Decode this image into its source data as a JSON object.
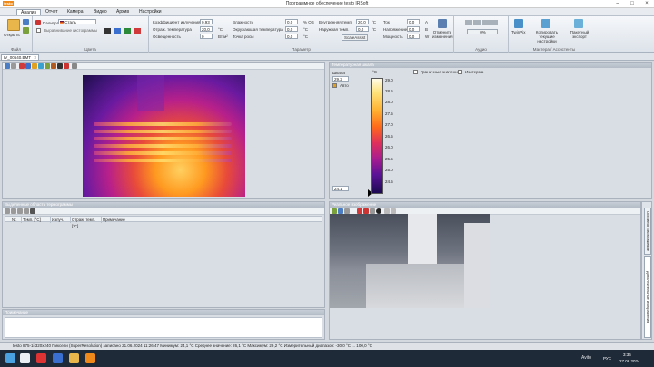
{
  "window": {
    "title": "Программное обеспечение testo IRSoft",
    "logo": "testo"
  },
  "menu": [
    "Анализ",
    "Отчет",
    "Камера",
    "Видео",
    "Архив",
    "Настройки"
  ],
  "ribbon": {
    "file": {
      "open": "Открыть",
      "label": "Файл"
    },
    "color": {
      "palette_label": "Палитра",
      "palette_value": "Сталь",
      "histogram": "Выравнивание гистограммы",
      "label": "Цвета"
    },
    "params": {
      "emissivity_label": "Коэффициент излучения",
      "emissivity": "0,93",
      "reflected_label": "Отраж. температура",
      "reflected": "20,0",
      "reflected_unit": "°C",
      "irradiance_label": "Освещенность",
      "irradiance": "0",
      "irradiance_unit": "Вт/м²",
      "humidity_label": "Влажность",
      "humidity": "0,0",
      "humidity_unit": "% ОВ",
      "ambient_label": "Окружающая температура",
      "ambient": "0,0",
      "ambient_unit": "°C",
      "dew_label": "Точка росы",
      "dew": "0,0",
      "dew_unit": "°C",
      "inner_label": "Внутренняя темп.",
      "inner": "20,0",
      "inner_unit": "°C",
      "outer_label": "Наружная темп.",
      "outer": "0,0",
      "outer_unit": "°C",
      "scaleassist": "ScaleAssist",
      "current_label": "Ток",
      "current": "0,0",
      "current_unit": "A",
      "voltage_label": "Напряжение",
      "voltage": "0,0",
      "voltage_unit": "B",
      "power_label": "Мощность",
      "power": "0,0",
      "power_unit": "W",
      "undo": "Отменить изменения",
      "label": "Параметр"
    },
    "audio": {
      "volume": "0%",
      "label": "Аудио"
    },
    "wizards": {
      "twinpix": "TwinPix",
      "copy": "Копировать текущие настройки",
      "export": "Пакетный экспорт",
      "label": "Мастера / Ассистенты"
    }
  },
  "document_tab": "IV_00640.BMT",
  "thermal_panel": {
    "title": ""
  },
  "scale_panel": {
    "title": "Температурная шкала",
    "limits": "Граничные значения",
    "isotherm": "Изотерма",
    "scale_label": "Шкала",
    "unit": "°C",
    "max": "29.2",
    "min": "24.1",
    "auto": "Авто",
    "ticks": [
      "29.0",
      "28.5",
      "28.0",
      "27.5",
      "27.0",
      "26.5",
      "26.0",
      "25.5",
      "25.0",
      "24.5"
    ]
  },
  "areas_panel": {
    "title": "Выделенные области термограммы",
    "columns": [
      "Nr.",
      "Темп. [°C]",
      "Излуч.",
      "Отраж. темп. [°C]",
      "Примечание"
    ]
  },
  "notes_panel": {
    "title": "Примечание"
  },
  "photo_panel": {
    "title": "Реальное изображение",
    "side_tabs": [
      "Основное изображение",
      "Дополнительные изображения"
    ]
  },
  "statusbar": "testo 875-1i  320x240  Пиксели (SuperResolution)  записано 21.06.2024  11:26:47   Минимум: 24,1 °C   Среднее значение: 26,1 °C   Максимум: 29,2 °C   Измерительный диапазон: -30,0 °C ... 100,0 °C",
  "taskbar": {
    "time": "3:36",
    "date": "27.06.2024",
    "lang": "РУС"
  },
  "watermark": "Avito",
  "colors": {
    "accent": "#ef8a1a",
    "ribbon": "#e3e8ee",
    "panel_head": "#b2bbc6"
  }
}
